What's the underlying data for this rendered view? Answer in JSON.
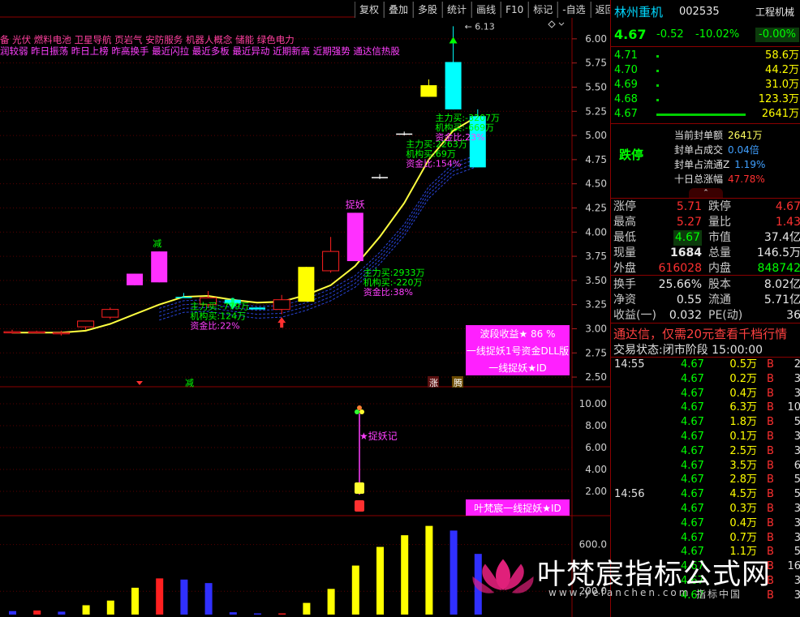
{
  "toolbar": [
    "复权",
    "叠加",
    "多股",
    "统计",
    "画线",
    "F10",
    "标记",
    "-自选",
    "返回"
  ],
  "top_text": {
    "concepts": "备 光伏 燃料电池 卫星导航 页岩气 安防服务 机器人概念 储能 绿色电力",
    "tags": "润较弱 昨日振荡 昨日上榜 昨高换手 最近闪拉 最近多板 最近异动 近期新高 近期强势 通达信热股"
  },
  "price_axis": [
    "6.00",
    "5.75",
    "5.50",
    "5.25",
    "5.00",
    "4.75",
    "4.50",
    "4.25",
    "4.00",
    "3.75",
    "3.50",
    "3.25",
    "3.00",
    "2.75",
    "2.50"
  ],
  "mid_axis": [
    "10.00",
    "8.00",
    "6.00",
    "4.00",
    "2.00"
  ],
  "vol_axis": [
    "600.0",
    "200.0"
  ],
  "chart_data": {
    "type": "candlestick",
    "price_ylim": [
      2.4,
      6.15
    ],
    "candles": [
      {
        "o": 2.97,
        "h": 2.99,
        "l": 2.95,
        "c": 2.96
      },
      {
        "o": 2.96,
        "h": 2.98,
        "l": 2.95,
        "c": 2.97
      },
      {
        "o": 2.96,
        "h": 2.98,
        "l": 2.93,
        "c": 2.95
      },
      {
        "o": 3.02,
        "h": 3.08,
        "l": 2.99,
        "c": 3.08
      },
      {
        "o": 3.12,
        "h": 3.22,
        "l": 3.1,
        "c": 3.2
      },
      {
        "o": 3.57,
        "h": 3.57,
        "l": 3.45,
        "c": 3.45
      },
      {
        "o": 3.8,
        "h": 3.8,
        "l": 3.48,
        "c": 3.48
      },
      {
        "o": 3.33,
        "h": 3.37,
        "l": 3.32,
        "c": 3.33
      },
      {
        "o": 3.25,
        "h": 3.39,
        "l": 3.22,
        "c": 3.32
      },
      {
        "o": 3.26,
        "h": 3.32,
        "l": 3.2,
        "c": 3.3
      },
      {
        "o": 3.2,
        "h": 3.22,
        "l": 3.2,
        "c": 3.22
      },
      {
        "o": 3.2,
        "h": 3.35,
        "l": 3.15,
        "c": 3.3
      },
      {
        "o": 3.28,
        "h": 3.64,
        "l": 3.28,
        "c": 3.64
      },
      {
        "o": 3.6,
        "h": 3.95,
        "l": 3.58,
        "c": 3.8
      },
      {
        "o": 3.7,
        "h": 4.2,
        "l": 3.7,
        "c": 4.2
      },
      {
        "o": 4.56,
        "h": 4.6,
        "l": 4.55,
        "c": 4.57
      },
      {
        "o": 5.02,
        "h": 5.04,
        "l": 5.0,
        "c": 5.02
      },
      {
        "o": 5.52,
        "h": 5.58,
        "l": 5.4,
        "c": 5.4
      },
      {
        "o": 5.76,
        "h": 6.13,
        "l": 5.27,
        "c": 5.27
      },
      {
        "o": 5.2,
        "h": 5.27,
        "l": 4.67,
        "c": 4.67
      }
    ],
    "candle_colors": [
      "#ff2020",
      "#ff2020",
      "#ff2020",
      "#ff2020",
      "#ff2020",
      "#ff30ff",
      "#ff30ff",
      "#00ffff",
      "#ff2020",
      "#00ffff",
      "#00ffff",
      "#ff2020",
      "#ffff00",
      "#ff2020",
      "#ff30ff",
      "#ffffff",
      "#ffffff",
      "#ffff00",
      "#00ffff",
      "#00ffff"
    ],
    "candle_hollow": [
      true,
      true,
      true,
      true,
      true,
      false,
      false,
      false,
      true,
      false,
      false,
      true,
      false,
      true,
      false,
      false,
      false,
      false,
      false,
      false
    ],
    "ma_line": [
      2.96,
      2.96,
      2.96,
      2.98,
      3.05,
      3.15,
      3.25,
      3.33,
      3.34,
      3.3,
      3.27,
      3.28,
      3.35,
      3.45,
      3.65,
      3.95,
      4.3,
      4.75,
      5.05,
      5.2
    ],
    "high_label": "6.13",
    "volume": [
      {
        "v": 30,
        "c": "#3030ff"
      },
      {
        "v": 35,
        "c": "#ff2020"
      },
      {
        "v": 25,
        "c": "#3030ff"
      },
      {
        "v": 80,
        "c": "#ffff00"
      },
      {
        "v": 120,
        "c": "#ffff00"
      },
      {
        "v": 230,
        "c": "#ffff00"
      },
      {
        "v": 310,
        "c": "#ff2020"
      },
      {
        "v": 300,
        "c": "#3030ff"
      },
      {
        "v": 270,
        "c": "#3030ff"
      },
      {
        "v": 20,
        "c": "#3030ff"
      },
      {
        "v": 10,
        "c": "#3030ff"
      },
      {
        "v": 10,
        "c": "#ff2020"
      },
      {
        "v": 100,
        "c": "#ffff00"
      },
      {
        "v": 220,
        "c": "#ffff00"
      },
      {
        "v": 420,
        "c": "#ffff00"
      },
      {
        "v": 580,
        "c": "#ffff00"
      },
      {
        "v": 680,
        "c": "#ffff00"
      },
      {
        "v": 760,
        "c": "#ffff00"
      },
      {
        "v": 720,
        "c": "#3030ff"
      },
      {
        "v": 520,
        "c": "#3030ff"
      }
    ],
    "volume_ylim": [
      0,
      820
    ]
  },
  "annotations": {
    "jian": "减",
    "zhuo1": "捉妖",
    "ann_a": [
      "主力买:-779万",
      "机构买:124万",
      "资金比:22%"
    ],
    "ann_b": [
      "主力买:2933万",
      "机构买:-220万",
      "资金比:38%"
    ],
    "ann_c": [
      "主力买:2263万",
      "机构买:69万",
      "资金比:154%"
    ],
    "ann_d": [
      "主力买:-3207万",
      "机构买:-669万",
      "资金比:23%"
    ],
    "box1": [
      "波段收益★ 86 %",
      "一线捉妖1号资金DLL版",
      "一线捉妖★ID"
    ],
    "box2": "叶梵宸一线捉妖★ID",
    "zhuoyaoji": "★捉妖记",
    "zhang": "涨",
    "teng": "腾",
    "jian2": "减"
  },
  "stock": {
    "name": "林州重机",
    "code": "002535",
    "sector": "工程机械",
    "price": "4.67",
    "change": "-0.52",
    "pct": "-10.02%",
    "sector_pct": "-0.00%"
  },
  "bids": [
    {
      "p": "4.71",
      "v": "58.6万"
    },
    {
      "p": "4.70",
      "v": "44.2万"
    },
    {
      "p": "4.69",
      "v": "31.0万"
    },
    {
      "p": "4.68",
      "v": "123.3万"
    },
    {
      "p": "4.67",
      "v": "2641万"
    }
  ],
  "limit": {
    "title": "跌停",
    "rows": [
      {
        "k": "当前封单额",
        "v": "2641万"
      },
      {
        "k": "封单占成交",
        "v": "0.04倍"
      },
      {
        "k": "封单占流通Z",
        "v": "1.19%"
      },
      {
        "k": "十日总涨幅",
        "v": "47.78%"
      }
    ]
  },
  "quote": [
    {
      "k1": "涨停",
      "v1": "5.71",
      "k2": "跌停",
      "v2": "4.67"
    },
    {
      "k1": "最高",
      "v1": "5.27",
      "k2": "量比",
      "v2": "1.43"
    },
    {
      "k1": "最低",
      "v1": "4.67",
      "k2": "市值",
      "v2": "37.4亿"
    },
    {
      "k1": "现量",
      "v1": "1684",
      "k2": "总量",
      "v2": "146.5万"
    },
    {
      "k1": "外盘",
      "v1": "616028",
      "k2": "内盘",
      "v2": "848742"
    }
  ],
  "quote2": [
    {
      "k1": "换手",
      "v1": "25.66%",
      "k2": "股本",
      "v2": "8.02亿"
    },
    {
      "k1": "净资",
      "v1": "0.55",
      "k2": "流通",
      "v2": "5.71亿"
    },
    {
      "k1": "收益(一)",
      "v1": "0.032",
      "k2": "PE(动)",
      "v2": "36"
    }
  ],
  "promo": "通达信，仅需20元查看千档行情",
  "trade_state": {
    "label": "交易状态:",
    "value": "闭市阶段 15:00:00"
  },
  "ticks": [
    {
      "t": "14:55",
      "p": "4.67",
      "v": "0.5万",
      "s": "B",
      "n": "2"
    },
    {
      "t": "",
      "p": "4.67",
      "v": "0.2万",
      "s": "B",
      "n": "3"
    },
    {
      "t": "",
      "p": "4.67",
      "v": "0.4万",
      "s": "B",
      "n": "3"
    },
    {
      "t": "",
      "p": "4.67",
      "v": "6.3万",
      "s": "B",
      "n": "10"
    },
    {
      "t": "",
      "p": "4.67",
      "v": "1.8万",
      "s": "B",
      "n": "5"
    },
    {
      "t": "",
      "p": "4.67",
      "v": "0.1万",
      "s": "B",
      "n": "3"
    },
    {
      "t": "",
      "p": "4.67",
      "v": "2.5万",
      "s": "B",
      "n": "3"
    },
    {
      "t": "",
      "p": "4.67",
      "v": "3.5万",
      "s": "B",
      "n": "6"
    },
    {
      "t": "",
      "p": "4.67",
      "v": "2.8万",
      "s": "B",
      "n": "5"
    },
    {
      "t": "14:56",
      "p": "4.67",
      "v": "4.5万",
      "s": "B",
      "n": "5"
    },
    {
      "t": "",
      "p": "4.67",
      "v": "0.3万",
      "s": "B",
      "n": "3"
    },
    {
      "t": "",
      "p": "4.67",
      "v": "0.4万",
      "s": "B",
      "n": "3"
    },
    {
      "t": "",
      "p": "4.67",
      "v": "0.7万",
      "s": "B",
      "n": "3"
    },
    {
      "t": "",
      "p": "4.67",
      "v": "1.1万",
      "s": "B",
      "n": "5"
    },
    {
      "t": "",
      "p": "4.67",
      "v": "",
      "s": "B",
      "n": "16"
    },
    {
      "t": "",
      "p": "4.67",
      "v": "",
      "s": "B",
      "n": "3"
    },
    {
      "t": "",
      "p": "4.67",
      "v": "",
      "s": "B",
      "n": "3"
    }
  ],
  "watermark": {
    "title": "叶梵宸指标公式网",
    "url": "www.yefanchen.com",
    "sub": "指标中国"
  }
}
